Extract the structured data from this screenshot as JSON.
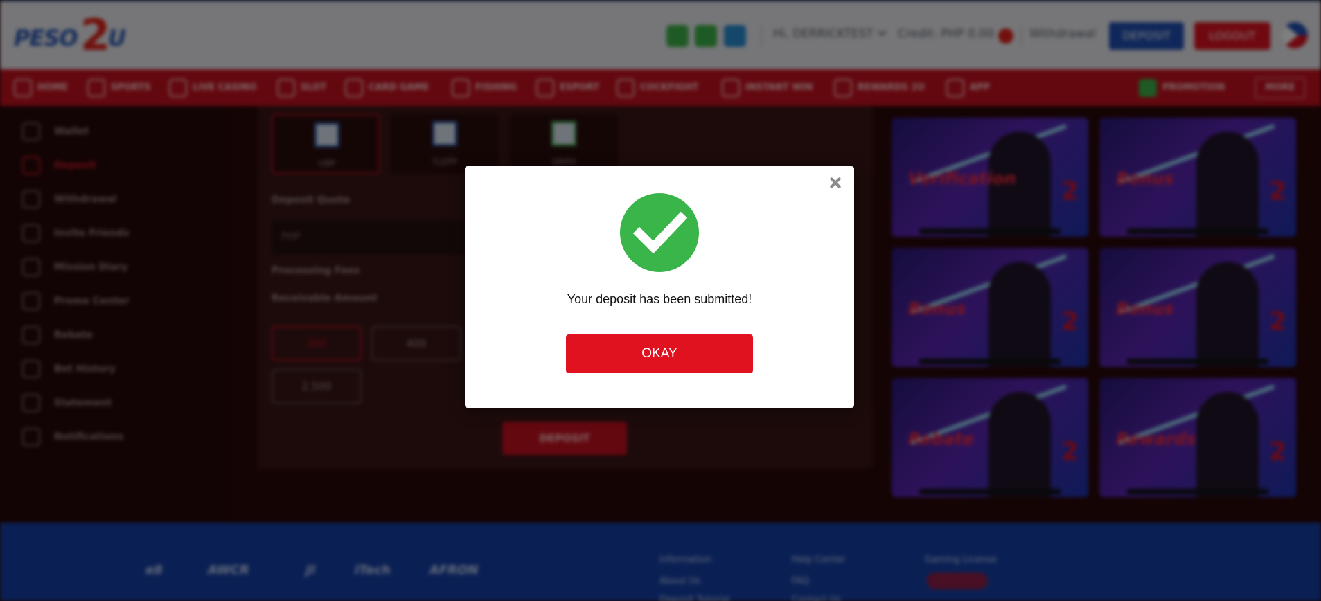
{
  "header": {
    "logo": "PESO2U",
    "user": "Hi, DERRICKTEST",
    "credit": "Credit: PHP 0.00",
    "withdrawal": "Withdrawal",
    "deposit_btn": "DEPOSIT",
    "logout_btn": "LOGOUT"
  },
  "nav": {
    "items": [
      "HOME",
      "SPORTS",
      "LIVE CASINO",
      "SLOT",
      "CARD GAME",
      "FISHING",
      "ESPORT",
      "COCKFIGHT",
      "INSTANT WIN",
      "REWARDS 2U",
      "APP"
    ],
    "promotion": "PROMOTION",
    "more": "MORE"
  },
  "sidebar": {
    "items": [
      "Wallet",
      "Deposit",
      "Withdrawal",
      "Invite Friends",
      "Mission Diary",
      "Promo Center",
      "Rebate",
      "Bet History",
      "Statement",
      "Notifications"
    ],
    "active": "Deposit"
  },
  "deposit_panel": {
    "methods": [
      "UBP",
      "TLEPP",
      "QRPH"
    ],
    "quota_label": "Deposit Quota",
    "currency": "PHP",
    "fees_label": "Processing Fees",
    "receivable_label": "Receivable Amount",
    "amounts": [
      "300",
      "400",
      "2,500"
    ],
    "submit": "DEPOSIT"
  },
  "promos": [
    {
      "word": "Verification",
      "num": "2"
    },
    {
      "word": "Bonus",
      "num": "2"
    },
    {
      "word": "Bonus",
      "num": "2"
    },
    {
      "word": "Bonus",
      "num": "2"
    },
    {
      "word": "Rebate",
      "num": "2"
    },
    {
      "word": "Rewards",
      "num": "2"
    }
  ],
  "footer": {
    "providers": [
      "e8",
      "AWCR",
      "Jl",
      "iTech",
      "AFRON"
    ],
    "info_heading": "Information",
    "info_links": [
      "About Us",
      "Deposit Tutorial"
    ],
    "help_heading": "Help Center",
    "help_links": [
      "FAQ",
      "Contact Us"
    ],
    "license_heading": "Gaming License"
  },
  "modal": {
    "message": "Your deposit has been submitted!",
    "ok_label": "OKAY"
  },
  "colors": {
    "brand_red": "#e0121f",
    "brand_blue": "#1f4fb5",
    "success_green": "#3ab54a"
  }
}
